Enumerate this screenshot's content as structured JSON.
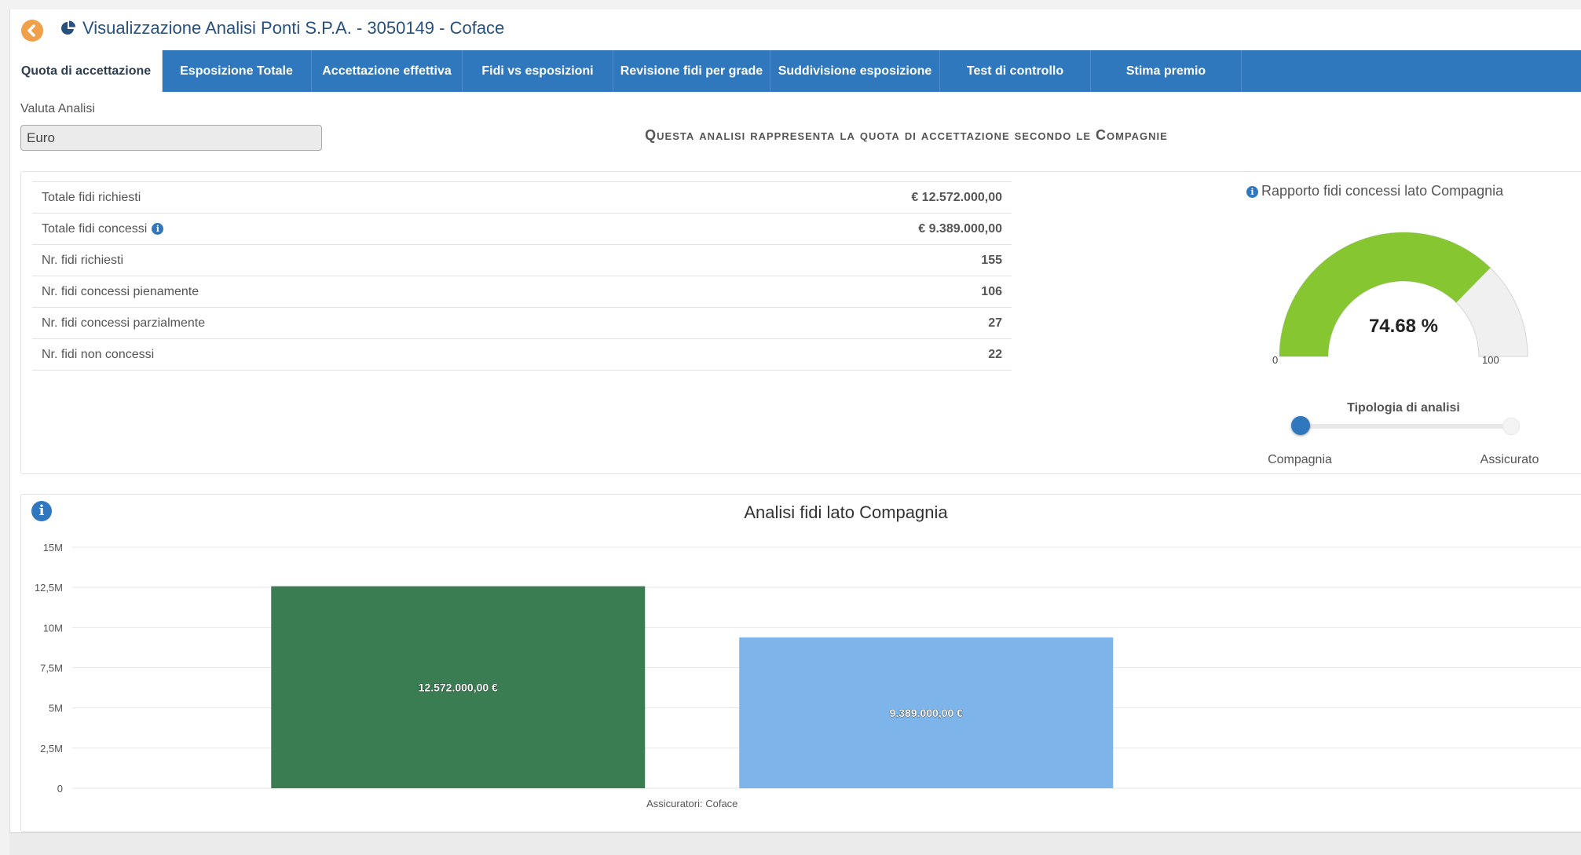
{
  "header": {
    "title": "Visualizzazione Analisi Ponti S.P.A. - 3050149 - Coface"
  },
  "tabs": [
    {
      "label": "Quota di accettazione",
      "active": true
    },
    {
      "label": "Esposizione Totale",
      "active": false
    },
    {
      "label": "Accettazione effettiva",
      "active": false
    },
    {
      "label": "Fidi vs esposizioni",
      "active": false
    },
    {
      "label": "Revisione fidi per grade",
      "active": false
    },
    {
      "label": "Suddivisione esposizione",
      "active": false
    },
    {
      "label": "Test di controllo",
      "active": false
    },
    {
      "label": "Stima premio",
      "active": false
    }
  ],
  "valuta": {
    "label": "Valuta Analisi",
    "value": "Euro"
  },
  "heading": "Questa analisi rappresenta la quota di accettazione secondo le Compagnie",
  "stats": [
    {
      "label": "Totale fidi richiesti",
      "value": "€ 12.572.000,00",
      "info": false
    },
    {
      "label": "Totale fidi concessi",
      "value": "€ 9.389.000,00",
      "info": true
    },
    {
      "label": "Nr. fidi richiesti",
      "value": "155",
      "info": false
    },
    {
      "label": "Nr. fidi concessi pienamente",
      "value": "106",
      "info": false
    },
    {
      "label": "Nr. fidi concessi parzialmente",
      "value": "27",
      "info": false
    },
    {
      "label": "Nr. fidi non concessi",
      "value": "22",
      "info": false
    }
  ],
  "gauge": {
    "title": "Rapporto fidi concessi lato Compagnia",
    "value": 74.68,
    "value_text": "74.68 %",
    "min": "0",
    "max": "100",
    "fill_color": "#85c631",
    "track_color": "#f0f0f0"
  },
  "switch": {
    "label": "Tipologia di analisi",
    "left_option": "Compagnia",
    "right_option": "Assicurato",
    "selected": "Compagnia"
  },
  "colors": {
    "primary": "#2f78be",
    "accent_back": "#f0a04b"
  },
  "chart_data": {
    "type": "bar",
    "title": "Analisi fidi lato Compagnia",
    "categories": [
      "Assicuratori: Coface"
    ],
    "series": [
      {
        "values": [
          12572000
        ],
        "label": "12.572.000,00 €",
        "color": "#3b7d52"
      },
      {
        "values": [
          9389000
        ],
        "label": "9.389.000,00 €",
        "color": "#7db4ea"
      }
    ],
    "ylim": [
      0,
      15000000
    ],
    "yticks": [
      0,
      2500000,
      5000000,
      7500000,
      10000000,
      12500000,
      15000000
    ],
    "ytick_labels": [
      "0",
      "2,5M",
      "5M",
      "7,5M",
      "10M",
      "12,5M",
      "15M"
    ],
    "grid": true
  }
}
